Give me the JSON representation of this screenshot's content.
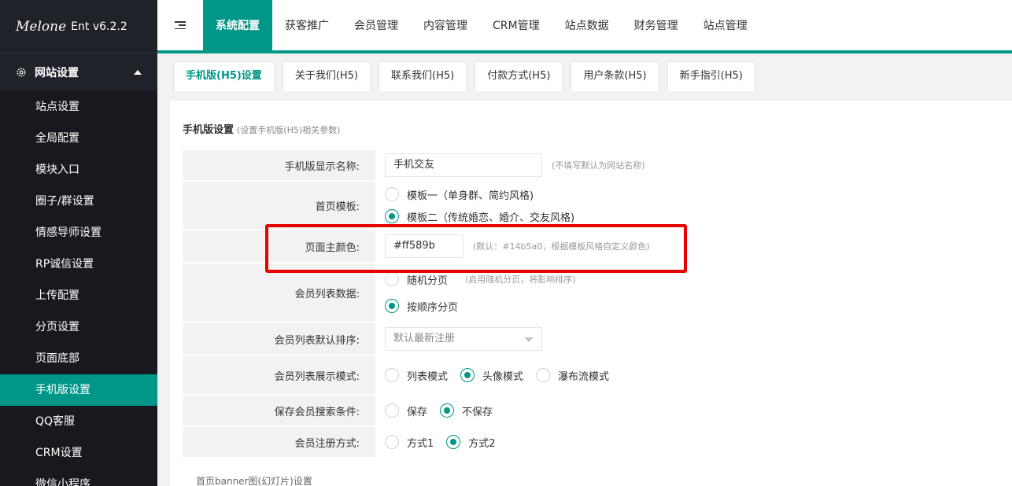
{
  "sidebar": {
    "logo": "Melone",
    "version": "Ent v6.2.2",
    "group": "网站设置",
    "items": [
      {
        "label": "站点设置"
      },
      {
        "label": "全局配置"
      },
      {
        "label": "模块入口"
      },
      {
        "label": "圈子/群设置"
      },
      {
        "label": "情感导师设置"
      },
      {
        "label": "RP诚信设置"
      },
      {
        "label": "上传配置"
      },
      {
        "label": "分页设置"
      },
      {
        "label": "页面底部"
      },
      {
        "label": "手机版设置"
      },
      {
        "label": "QQ客服"
      },
      {
        "label": "CRM设置"
      },
      {
        "label": "微信小程序"
      }
    ]
  },
  "topnav": {
    "items": [
      {
        "label": "系统配置"
      },
      {
        "label": "获客推广"
      },
      {
        "label": "会员管理"
      },
      {
        "label": "内容管理"
      },
      {
        "label": "CRM管理"
      },
      {
        "label": "站点数据"
      },
      {
        "label": "财务管理"
      },
      {
        "label": "站点管理"
      }
    ]
  },
  "tabs": [
    {
      "label": "手机版(H5)设置"
    },
    {
      "label": "关于我们(H5)"
    },
    {
      "label": "联系我们(H5)"
    },
    {
      "label": "付款方式(H5)"
    },
    {
      "label": "用户条款(H5)"
    },
    {
      "label": "新手指引(H5)"
    }
  ],
  "section": {
    "title": "手机版设置",
    "hint": "(设置手机版(H5)相关参数)"
  },
  "form": {
    "mobile_name": {
      "label": "手机版显示名称:",
      "value": "手机交友",
      "tip": "(不填写默认为网站名称)"
    },
    "home_template": {
      "label": "首页模板:",
      "option1": "模板一（单身群、简约风格)",
      "option2": "模板二（传统婚恋、婚介、交友风格)"
    },
    "theme_color": {
      "label": "页面主颜色:",
      "value": "#ff589b",
      "tip": "(默认：#14b5a0，根据模板风格自定义颜色)"
    },
    "member_list": {
      "label": "会员列表数据:",
      "option1": "随机分页",
      "option1_tip": "(启用随机分页，将影响排序)",
      "option2": "按顺序分页"
    },
    "list_sort": {
      "label": "会员列表默认排序:",
      "value": "默认最新注册"
    },
    "list_display": {
      "label": "会员列表展示模式:",
      "option1": "列表模式",
      "option2": "头像模式",
      "option3": "瀑布流模式"
    },
    "save_search": {
      "label": "保存会员搜索条件:",
      "option1": "保存",
      "option2": "不保存"
    },
    "register_mode": {
      "label": "会员注册方式:",
      "option1": "方式1",
      "option2": "方式2"
    }
  },
  "bottom_note": "首页banner图(幻灯片)设置"
}
